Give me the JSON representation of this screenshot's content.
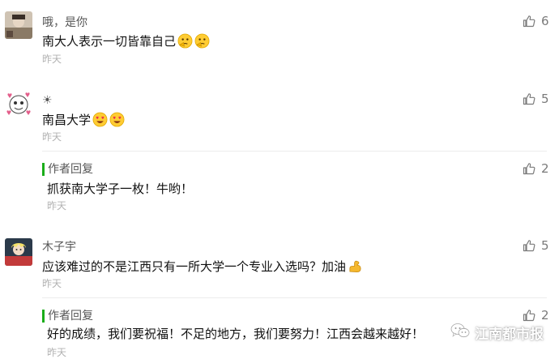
{
  "comments": [
    {
      "nickname": "哦，是你",
      "content": "南大人表示一切皆靠自己",
      "emojis": [
        "thinking-emoji",
        "thinking-emoji"
      ],
      "time": "昨天",
      "likes": "6"
    },
    {
      "nickname": "☀",
      "content": "南昌大学",
      "emojis": [
        "heart-eyes-emoji",
        "heart-eyes-emoji"
      ],
      "time": "昨天",
      "likes": "5",
      "reply": {
        "label": "作者回复",
        "content": "抓获南大学子一枚！牛哟！",
        "time": "昨天",
        "likes": "2"
      }
    },
    {
      "nickname": "木子宇",
      "content": "应该难过的不是江西只有一所大学一个专业入选吗？加油",
      "emojis": [
        "flexed-biceps-emoji"
      ],
      "time": "昨天",
      "likes": "5",
      "reply": {
        "label": "作者回复",
        "content": "好的成绩，我们要祝福！不足的地方，我们要努力！江西会越来越好！",
        "time": "昨天",
        "likes": "2"
      }
    }
  ],
  "watermark": {
    "text": "江南都市报",
    "icon": "wechat-icon"
  },
  "colors": {
    "reply_bar": "#1aad19",
    "time": "#b2b2b2",
    "like": "#7a7a7a",
    "divider": "#ececec"
  }
}
